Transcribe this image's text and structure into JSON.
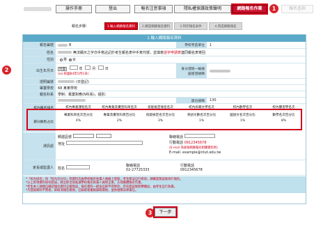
{
  "topbar": {
    "blurred_user": "",
    "buttons": [
      {
        "label": "操作手冊"
      },
      {
        "label": "登出"
      },
      {
        "label": "報名注意事項"
      },
      {
        "label": "隱私權保護政策聲明"
      },
      {
        "label": "網路報名作業"
      },
      {
        "label": "報名查詢"
      }
    ]
  },
  "badges": {
    "b1": "1",
    "b2": "2",
    "b3": "3"
  },
  "steps": {
    "label": "報名步驟：",
    "items": [
      "1.輸入網路報名資料",
      "2.確認網路報名資料",
      "3.列印報名表件",
      "4.完成網路報名"
    ]
  },
  "form": {
    "header": "1.輸入網路報名資料",
    "group_no_label": "報名編號",
    "group_no_value": "B",
    "unit_label": "學校考區單位",
    "unit_value": "1",
    "name_label": "姓名",
    "name_note_prefix": "無法顯示之字亦手寫註記於考生報名表中手寫代號，並填寫",
    "name_note_red": "造字申請表",
    "name_note_suffix": "連同報名表寄回",
    "gender_label": "性別",
    "gender_male": "男",
    "gender_female": "女",
    "birth_label": "出生年月日",
    "birth_era": "民國",
    "birth_hint": "(ex:民國84年5月1日)",
    "year_unit": "年",
    "month_unit": "月",
    "day_unit": "日",
    "id_label": "身分證統一編號",
    "id_hint": "居留證號碼",
    "id_type_label": "證照編號",
    "id_type_value": "(日登記)",
    "school_label": "畢業學校",
    "school_value": "68 某某學校",
    "dept_label": "報名科系",
    "dept_value": "學制：專業對應(N科系)，組別：",
    "seat_label": "座位號碼",
    "seat_value": "130",
    "score_row1_label": "校內報名排名",
    "score_row2_label": "部分群別占比",
    "scores": [
      {
        "h": "校內專業課程名次",
        "v": "4%"
      },
      {
        "h": "校內專業及實習科目名次",
        "v": "2%"
      },
      {
        "h": "技能檢定報名名次",
        "v": "3%"
      },
      {
        "h": "校內高職文學名次",
        "v": "1%"
      },
      {
        "h": "校內數學名次",
        "v": "1%"
      },
      {
        "h": "校內實習學名次",
        "v": "8%"
      }
    ],
    "scores_row2": [
      {
        "h": "專業科目名次百分比",
        "v": "4%"
      },
      {
        "h": "專業及實習科目百分比",
        "v": "2%"
      },
      {
        "h": "技能檢定名次百分比",
        "v": "3%"
      },
      {
        "h": "英語文數名次百分比",
        "v": "1%"
      },
      {
        "h": "國語文名次百分比",
        "v": "1%"
      },
      {
        "h": "數學名次百分比",
        "v": "8%"
      }
    ],
    "contact_label": "通訊處",
    "zip_label": "郵遞區號",
    "addr_label": "地址",
    "phone_label": "聯絡電話",
    "mobile_label": "行動電話",
    "mobile_value": "0912345678",
    "email_label": "E-mail",
    "email_value": "example@ntut.edu.tw",
    "email_note": "(E-mail 為接收網路報名相關資料用)",
    "guardian_label": "家長或監護人",
    "guardian_name_label": "姓名",
    "guardian_phone_label": "聯絡電話",
    "guardian_phone_value": "02-27725333",
    "guardian_mobile_label": "行動電話",
    "guardian_mobile_value": "0912345678",
    "ph_value": "02-27725333",
    "notes": [
      "*「校內排名」與「校內百分比」等資料均由學校報名負責人員線上登錄，考生無法自行修改，請確認無誤後再行報名。",
      "*以上各項資料如有錯誤，請立即洽詢就讀學校報名負責人員修正後，方得繼續報名作業。",
      "*考生本人請親自確認報名資料正確無誤，報名資料一經送出即不得更改，若有錯誤致影響權益，由考生自行負責。",
      "*凡登錄資料不實者，即取消報名資格，已錄取者撤銷錄取資格，並負相關法律責任。"
    ]
  },
  "next_button": "下一步"
}
